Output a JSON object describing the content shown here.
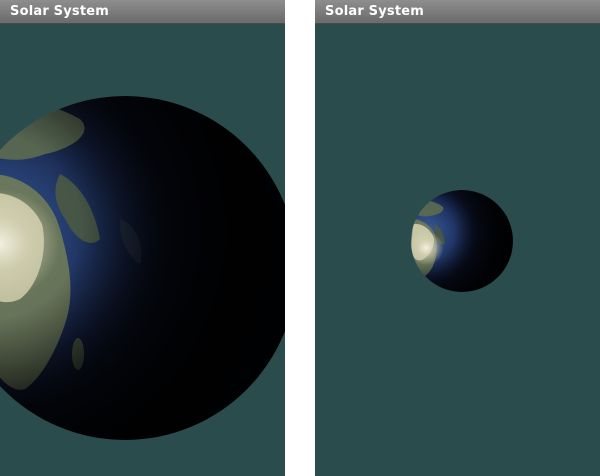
{
  "screens": [
    {
      "title": "Solar System"
    },
    {
      "title": "Solar System"
    }
  ],
  "colors": {
    "background": "#2a4c4c",
    "titlebar": "#7a7a7a",
    "title_text": "#ffffff"
  },
  "scene": {
    "object": "earth-globe",
    "lit_side": "left"
  }
}
